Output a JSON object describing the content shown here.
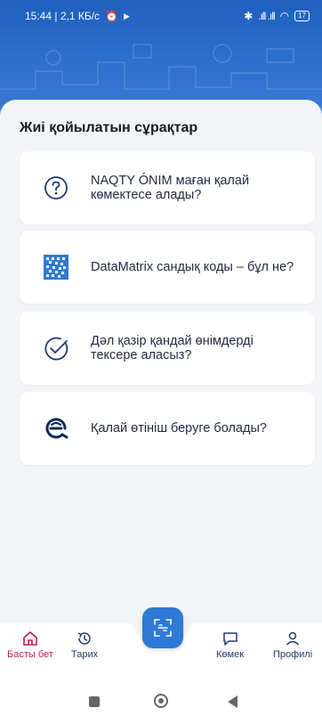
{
  "status_bar": {
    "left_text": "15:44 | 2,1 КБ/с",
    "battery": "17"
  },
  "page": {
    "title": "Жиі қойылатын сұрақтар"
  },
  "faq": [
    {
      "icon": "question-circle-icon",
      "text": "NAQTY ÓNIM маған қалай көмектесе алады?"
    },
    {
      "icon": "datamatrix-code-icon",
      "text": "DataMatrix сандық коды – бұл не?"
    },
    {
      "icon": "check-circle-icon",
      "text": "Дәл қазір қандай өнімдерді тексере аласыз?"
    },
    {
      "icon": "e-logo-icon",
      "text": "Қалай өтініш беруге болады?"
    }
  ],
  "bottom_nav": {
    "home": "Басты бет",
    "history": "Тарих",
    "help": "Көмек",
    "profile": "Профилі"
  },
  "colors": {
    "accent": "#2e7ad6",
    "active": "#c2185b",
    "text": "#1f2a44"
  }
}
